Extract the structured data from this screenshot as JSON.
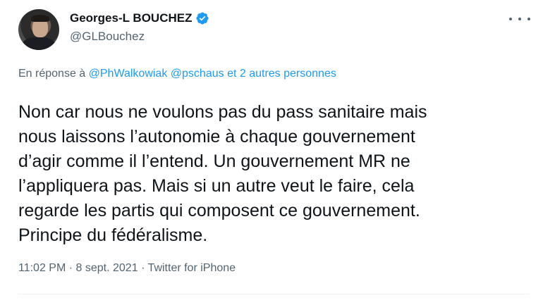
{
  "author": {
    "display_name": "Georges-L BOUCHEZ",
    "handle": "@GLBouchez",
    "verified": true,
    "verified_color": "#1d9bf0"
  },
  "menu_icon": "more-horizontal-icon",
  "reply": {
    "prefix": "En réponse à",
    "mentions": [
      "@PhWalkowiak",
      "@pschaus"
    ],
    "others": "et 2 autres personnes"
  },
  "tweet_text": "Non car nous ne voulons pas du pass sanitaire mais\nnous laissons l’autonomie à chaque gouvernement\nd’agir comme il l’entend. Un gouvernement MR ne\nl’appliquera pas. Mais si un autre veut le faire, cela\nregarde les partis qui composent ce gouvernement.\nPrincipe du fédéralisme.",
  "meta": {
    "time": "11:02 PM",
    "separator": "·",
    "date": "8 sept. 2021",
    "source": "Twitter for iPhone"
  },
  "colors": {
    "link": "#1d9bf0",
    "secondary_text": "#536471",
    "primary_text": "#0f1419"
  }
}
